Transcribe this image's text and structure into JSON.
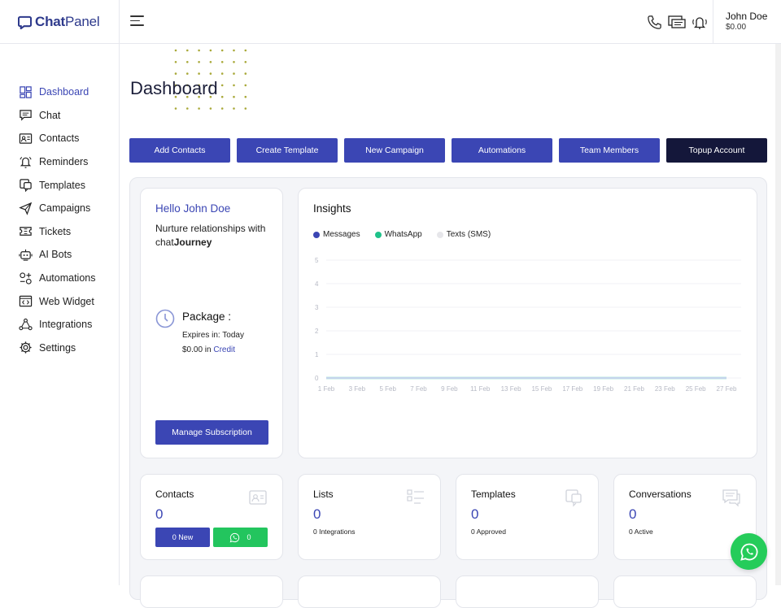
{
  "brand": {
    "name_bold": "Chat",
    "name_light": "Panel"
  },
  "header": {
    "user_name": "John Doe",
    "user_balance": "$0.00",
    "icons": [
      "phone-icon",
      "chat-screen-icon",
      "bell-icon"
    ]
  },
  "sidebar": {
    "items": [
      {
        "label": "Dashboard",
        "icon": "grid-icon",
        "active": true
      },
      {
        "label": "Chat",
        "icon": "chat-icon"
      },
      {
        "label": "Contacts",
        "icon": "contact-card-icon"
      },
      {
        "label": "Reminders",
        "icon": "bell-icon"
      },
      {
        "label": "Templates",
        "icon": "template-icon"
      },
      {
        "label": "Campaigns",
        "icon": "send-icon"
      },
      {
        "label": "Tickets",
        "icon": "ticket-icon"
      },
      {
        "label": "AI Bots",
        "icon": "bot-icon"
      },
      {
        "label": "Automations",
        "icon": "automation-icon"
      },
      {
        "label": "Web Widget",
        "icon": "code-icon"
      },
      {
        "label": "Integrations",
        "icon": "integrations-icon"
      },
      {
        "label": "Settings",
        "icon": "gear-icon"
      }
    ]
  },
  "main": {
    "title": "Dashboard",
    "actions": [
      "Add Contacts",
      "Create Template",
      "New Campaign",
      "Automations",
      "Team Members",
      "Topup Account"
    ]
  },
  "hello_card": {
    "greeting": "Hello John Doe",
    "nurture_prefix": "Nurture relationships with chat",
    "nurture_bold": "Journey",
    "package_title": "Package :",
    "expires": "Expires in: Today",
    "credit_amount": "$0.00 in",
    "credit_link": "Credit",
    "manage_button": "Manage Subscription"
  },
  "insights": {
    "title": "Insights"
  },
  "chart_data": {
    "type": "line",
    "x": [
      "1 Feb",
      "3 Feb",
      "5 Feb",
      "7 Feb",
      "9 Feb",
      "11 Feb",
      "13 Feb",
      "15 Feb",
      "17 Feb",
      "19 Feb",
      "21 Feb",
      "23 Feb",
      "25 Feb",
      "27 Feb"
    ],
    "series": [
      {
        "name": "Messages",
        "color": "#3b46b4",
        "values": [
          0,
          0,
          0,
          0,
          0,
          0,
          0,
          0,
          0,
          0,
          0,
          0,
          0,
          0
        ]
      },
      {
        "name": "WhatsApp",
        "color": "#1fc28a",
        "values": [
          0,
          0,
          0,
          0,
          0,
          0,
          0,
          0,
          0,
          0,
          0,
          0,
          0,
          0
        ]
      },
      {
        "name": "Texts (SMS)",
        "color": "#e6e6ea",
        "values": [
          0,
          0,
          0,
          0,
          0,
          0,
          0,
          0,
          0,
          0,
          0,
          0,
          0,
          0
        ]
      }
    ],
    "yticks": [
      "0",
      "1",
      "2",
      "3",
      "4",
      "5"
    ],
    "ylim": [
      0,
      5
    ],
    "legend": "top-left",
    "grid": true
  },
  "stats": [
    {
      "title": "Contacts",
      "value": "0",
      "icon": "contact-card-icon",
      "new_label": "0 New",
      "whatsapp_label": "0"
    },
    {
      "title": "Lists",
      "value": "0",
      "sub": "0 Integrations",
      "icon": "list-icon"
    },
    {
      "title": "Templates",
      "value": "0",
      "sub": "0 Approved",
      "icon": "template-icon"
    },
    {
      "title": "Conversations",
      "value": "0",
      "sub": "0 Active",
      "icon": "conversation-icon"
    }
  ],
  "colors": {
    "accent": "#3b46b4",
    "dark": "#14173a",
    "whatsapp": "#25cc5a"
  }
}
